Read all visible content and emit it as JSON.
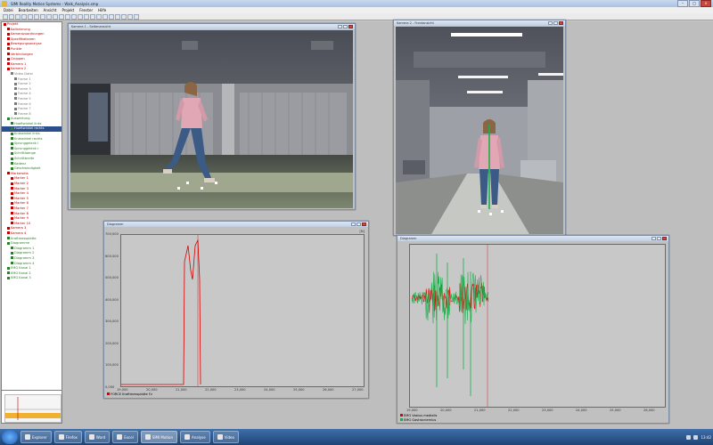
{
  "window": {
    "title": "SIMI Reality Motion Systems - Walk_Analysis.smp"
  },
  "menu": [
    "Datei",
    "Bearbeiten",
    "Ansicht",
    "Projekt",
    "Fenster",
    "Hilfe"
  ],
  "tree_items": [
    {
      "label": "Projekt",
      "indent": 0,
      "color": "#c00000"
    },
    {
      "label": "Kalibrierung",
      "indent": 1,
      "color": "#c00000"
    },
    {
      "label": "Kamerazuordnungen",
      "indent": 1,
      "color": "#c00000"
    },
    {
      "label": "Spezifikationen",
      "indent": 1,
      "color": "#c00000"
    },
    {
      "label": "Bewegungsanalyse",
      "indent": 1,
      "color": "#c00000"
    },
    {
      "label": "Punkte",
      "indent": 1,
      "color": "#c00000"
    },
    {
      "label": "Verbindungen",
      "indent": 1,
      "color": "#c00000"
    },
    {
      "label": "Gruppen",
      "indent": 1,
      "color": "#c00000"
    },
    {
      "label": "Kamera 1",
      "indent": 1,
      "color": "#c00000"
    },
    {
      "label": "Kamera 2",
      "indent": 1,
      "color": "#c00000"
    },
    {
      "label": "Video Datei",
      "indent": 2,
      "color": "#7a7a7a"
    },
    {
      "label": "Frame 1",
      "indent": 3,
      "color": "#7a7a7a"
    },
    {
      "label": "Frame 2",
      "indent": 3,
      "color": "#7a7a7a"
    },
    {
      "label": "Frame 3",
      "indent": 3,
      "color": "#7a7a7a"
    },
    {
      "label": "Frame 4",
      "indent": 3,
      "color": "#7a7a7a"
    },
    {
      "label": "Frame 5",
      "indent": 3,
      "color": "#7a7a7a"
    },
    {
      "label": "Frame 6",
      "indent": 3,
      "color": "#7a7a7a"
    },
    {
      "label": "Frame 7",
      "indent": 3,
      "color": "#7a7a7a"
    },
    {
      "label": "Frame 8",
      "indent": 3,
      "color": "#7a7a7a"
    },
    {
      "label": "Auswertung",
      "indent": 1,
      "color": "#2f7d2f"
    },
    {
      "label": "Hueftwinkel links",
      "indent": 2,
      "color": "#2f7d2f"
    },
    {
      "label": "Hueftwinkel rechts",
      "indent": 2,
      "color": "#2f7d2f",
      "selected": true
    },
    {
      "label": "Kniewinkel links",
      "indent": 2,
      "color": "#2f7d2f"
    },
    {
      "label": "Kniewinkel rechts",
      "indent": 2,
      "color": "#2f7d2f"
    },
    {
      "label": "Sprunggelenk l",
      "indent": 2,
      "color": "#2f7d2f"
    },
    {
      "label": "Sprunggelenk r",
      "indent": 2,
      "color": "#2f7d2f"
    },
    {
      "label": "Schrittlaenge",
      "indent": 2,
      "color": "#2f7d2f"
    },
    {
      "label": "Schrittbreite",
      "indent": 2,
      "color": "#2f7d2f"
    },
    {
      "label": "Kadenz",
      "indent": 2,
      "color": "#2f7d2f"
    },
    {
      "label": "Geschwindigkeit",
      "indent": 2,
      "color": "#2f7d2f"
    },
    {
      "label": "Markersets",
      "indent": 1,
      "color": "#c00000"
    },
    {
      "label": "Marker 1",
      "indent": 2,
      "color": "#c00000"
    },
    {
      "label": "Marker 2",
      "indent": 2,
      "color": "#c00000"
    },
    {
      "label": "Marker 3",
      "indent": 2,
      "color": "#c00000"
    },
    {
      "label": "Marker 4",
      "indent": 2,
      "color": "#c00000"
    },
    {
      "label": "Marker 5",
      "indent": 2,
      "color": "#c00000"
    },
    {
      "label": "Marker 6",
      "indent": 2,
      "color": "#c00000"
    },
    {
      "label": "Marker 7",
      "indent": 2,
      "color": "#c00000"
    },
    {
      "label": "Marker 8",
      "indent": 2,
      "color": "#c00000"
    },
    {
      "label": "Marker 9",
      "indent": 2,
      "color": "#c00000"
    },
    {
      "label": "Marker 10",
      "indent": 2,
      "color": "#c00000"
    },
    {
      "label": "Kamera 3",
      "indent": 1,
      "color": "#c00000"
    },
    {
      "label": "Kamera 4",
      "indent": 1,
      "color": "#c00000"
    },
    {
      "label": "Kraftmessplatte",
      "indent": 1,
      "color": "#2f7d2f"
    },
    {
      "label": "Diagramme",
      "indent": 1,
      "color": "#2f7d2f"
    },
    {
      "label": "Diagramm 1",
      "indent": 2,
      "color": "#2f7d2f"
    },
    {
      "label": "Diagramm 2",
      "indent": 2,
      "color": "#2f7d2f"
    },
    {
      "label": "Diagramm 3",
      "indent": 2,
      "color": "#2f7d2f"
    },
    {
      "label": "Diagramm 4",
      "indent": 2,
      "color": "#2f7d2f"
    },
    {
      "label": "EMG Kanal 1",
      "indent": 1,
      "color": "#2f7d2f"
    },
    {
      "label": "EMG Kanal 2",
      "indent": 1,
      "color": "#2f7d2f"
    },
    {
      "label": "EMG Kanal 3",
      "indent": 1,
      "color": "#2f7d2f"
    }
  ],
  "video1": {
    "title": "Kamera 1 - Seitenansicht"
  },
  "video2": {
    "title": "Kamera 2 - Frontansicht"
  },
  "chart1": {
    "window_title": "Diagramm",
    "legend": "FORCE Kraftmessplatte Fz",
    "corner_label": "[N]",
    "y_ticks": [
      "700,000",
      "600,000",
      "500,000",
      "400,000",
      "300,000",
      "200,000",
      "100,000",
      "0,000"
    ],
    "x_ticks": [
      "19,000",
      "20,000",
      "21,000",
      "22,000",
      "23,000",
      "24,000",
      "25,000",
      "26,000",
      "27,000"
    ],
    "line_color": "#d40000"
  },
  "chart2": {
    "window_title": "Diagramm",
    "legend1": "EMG Vastus medialis",
    "legend2": "EMG Gastrocnemius",
    "x_ticks": [
      "19,000",
      "20,000",
      "21,000",
      "22,000",
      "23,000",
      "24,000",
      "25,000",
      "26,000"
    ],
    "series_colors": [
      "#e00000",
      "#19b04a"
    ]
  },
  "taskbar": {
    "items": [
      "Explorer",
      "Firefox",
      "Word",
      "Excel",
      "SIMI Motion",
      "Analyse",
      "Video"
    ],
    "clock": "13:42"
  }
}
